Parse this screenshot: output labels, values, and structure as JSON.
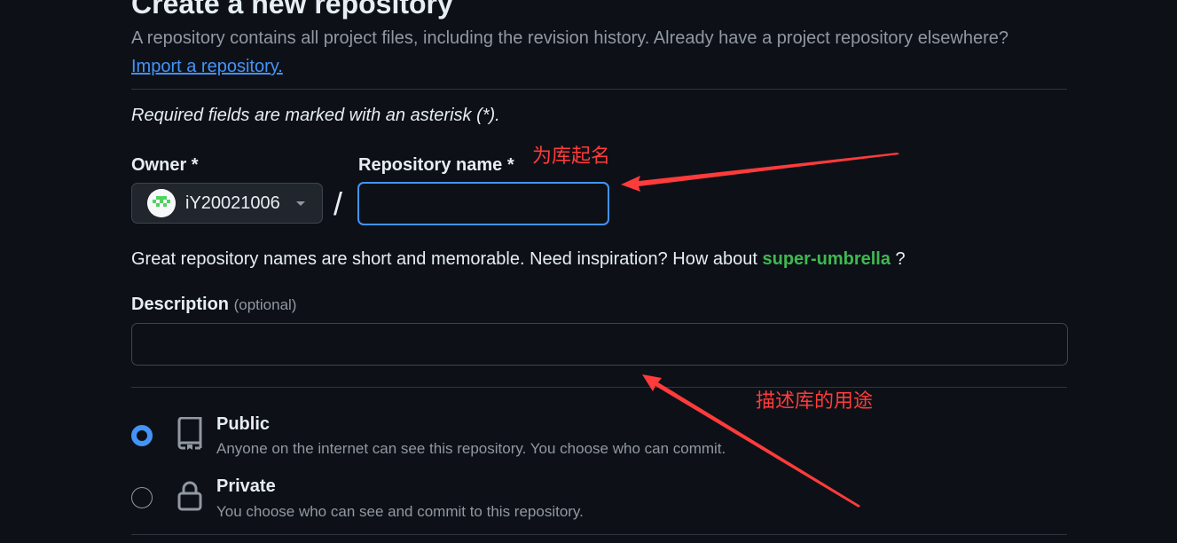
{
  "header": {
    "title": "Create a new repository",
    "subtitle": "A repository contains all project files, including the revision history. Already have a project repository elsewhere?",
    "import_link": "Import a repository."
  },
  "form": {
    "required_note": "Required fields are marked with an asterisk (*).",
    "owner_label": "Owner *",
    "owner_value": "iY20021006",
    "slash": "/",
    "repo_name_label": "Repository name *",
    "repo_name_value": "",
    "hint_prefix": "Great repository names are short and memorable. Need inspiration? How about",
    "hint_suggestion": "super-umbrella",
    "hint_suffix": "?",
    "description_label": "Description",
    "description_optional": "(optional)",
    "description_value": ""
  },
  "visibility": {
    "selected": "public",
    "options": [
      {
        "title": "Public",
        "description": "Anyone on the internet can see this repository. You choose who can commit."
      },
      {
        "title": "Private",
        "description": "You choose who can see and commit to this repository."
      }
    ]
  },
  "annotations": {
    "name_note": "为库起名",
    "description_note": "描述库的用途",
    "color": "#ff3b3b"
  },
  "colors": {
    "background": "#0d1117",
    "accent": "#4493f8",
    "suggestion": "#3fb950"
  }
}
